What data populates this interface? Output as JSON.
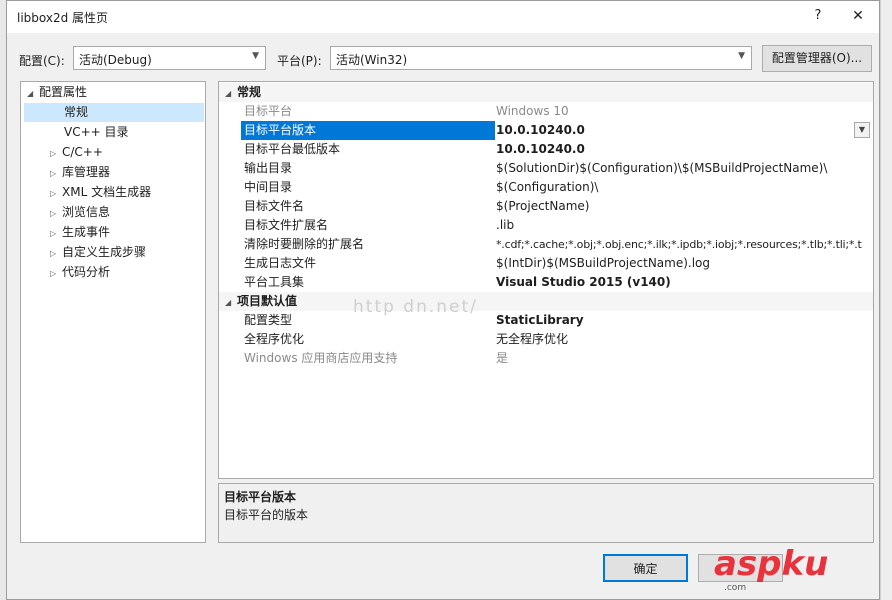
{
  "window": {
    "title": "libbox2d 属性页",
    "help_label": "?",
    "close_label": "✕"
  },
  "toolbar": {
    "config_label": "配置(C):",
    "config_value": "活动(Debug)",
    "platform_label": "平台(P):",
    "platform_value": "活动(Win32)",
    "config_manager_label": "配置管理器(O)..."
  },
  "tree": {
    "root": "配置属性",
    "items": [
      {
        "label": "常规",
        "selected": true,
        "expandable": false
      },
      {
        "label": "VC++ 目录",
        "selected": false,
        "expandable": false
      },
      {
        "label": "C/C++",
        "selected": false,
        "expandable": true
      },
      {
        "label": "库管理器",
        "selected": false,
        "expandable": true
      },
      {
        "label": "XML 文档生成器",
        "selected": false,
        "expandable": true
      },
      {
        "label": "浏览信息",
        "selected": false,
        "expandable": true
      },
      {
        "label": "生成事件",
        "selected": false,
        "expandable": true
      },
      {
        "label": "自定义生成步骤",
        "selected": false,
        "expandable": true
      },
      {
        "label": "代码分析",
        "selected": false,
        "expandable": true
      }
    ]
  },
  "grid": {
    "sections": [
      {
        "title": "常规",
        "rows": [
          {
            "name": "目标平台",
            "value": "Windows 10",
            "style": "grey"
          },
          {
            "name": "目标平台版本",
            "value": "10.0.10240.0",
            "style": "bold",
            "selected": true
          },
          {
            "name": "目标平台最低版本",
            "value": "10.0.10240.0",
            "style": "bold"
          },
          {
            "name": "输出目录",
            "value": "$(SolutionDir)$(Configuration)\\$(MSBuildProjectName)\\",
            "style": "normal"
          },
          {
            "name": "中间目录",
            "value": "$(Configuration)\\",
            "style": "normal"
          },
          {
            "name": "目标文件名",
            "value": "$(ProjectName)",
            "style": "normal"
          },
          {
            "name": "目标文件扩展名",
            "value": ".lib",
            "style": "normal"
          },
          {
            "name": "清除时要删除的扩展名",
            "value": "*.cdf;*.cache;*.obj;*.obj.enc;*.ilk;*.ipdb;*.iobj;*.resources;*.tlb;*.tli;*.t",
            "style": "normal"
          },
          {
            "name": "生成日志文件",
            "value": "$(IntDir)$(MSBuildProjectName).log",
            "style": "normal"
          },
          {
            "name": "平台工具集",
            "value": "Visual Studio 2015 (v140)",
            "style": "bold"
          }
        ]
      },
      {
        "title": "项目默认值",
        "rows": [
          {
            "name": "配置类型",
            "value": "StaticLibrary",
            "style": "bold"
          },
          {
            "name": "全程序优化",
            "value": "无全程序优化",
            "style": "normal"
          },
          {
            "name": "Windows 应用商店应用支持",
            "value": "是",
            "style": "grey"
          }
        ]
      }
    ]
  },
  "description": {
    "title": "目标平台版本",
    "text": "目标平台的版本"
  },
  "buttons": {
    "ok_label": "确定"
  },
  "watermark": "http    dn.net/",
  "logo": {
    "text": "aspku",
    "suffix": ".com"
  }
}
